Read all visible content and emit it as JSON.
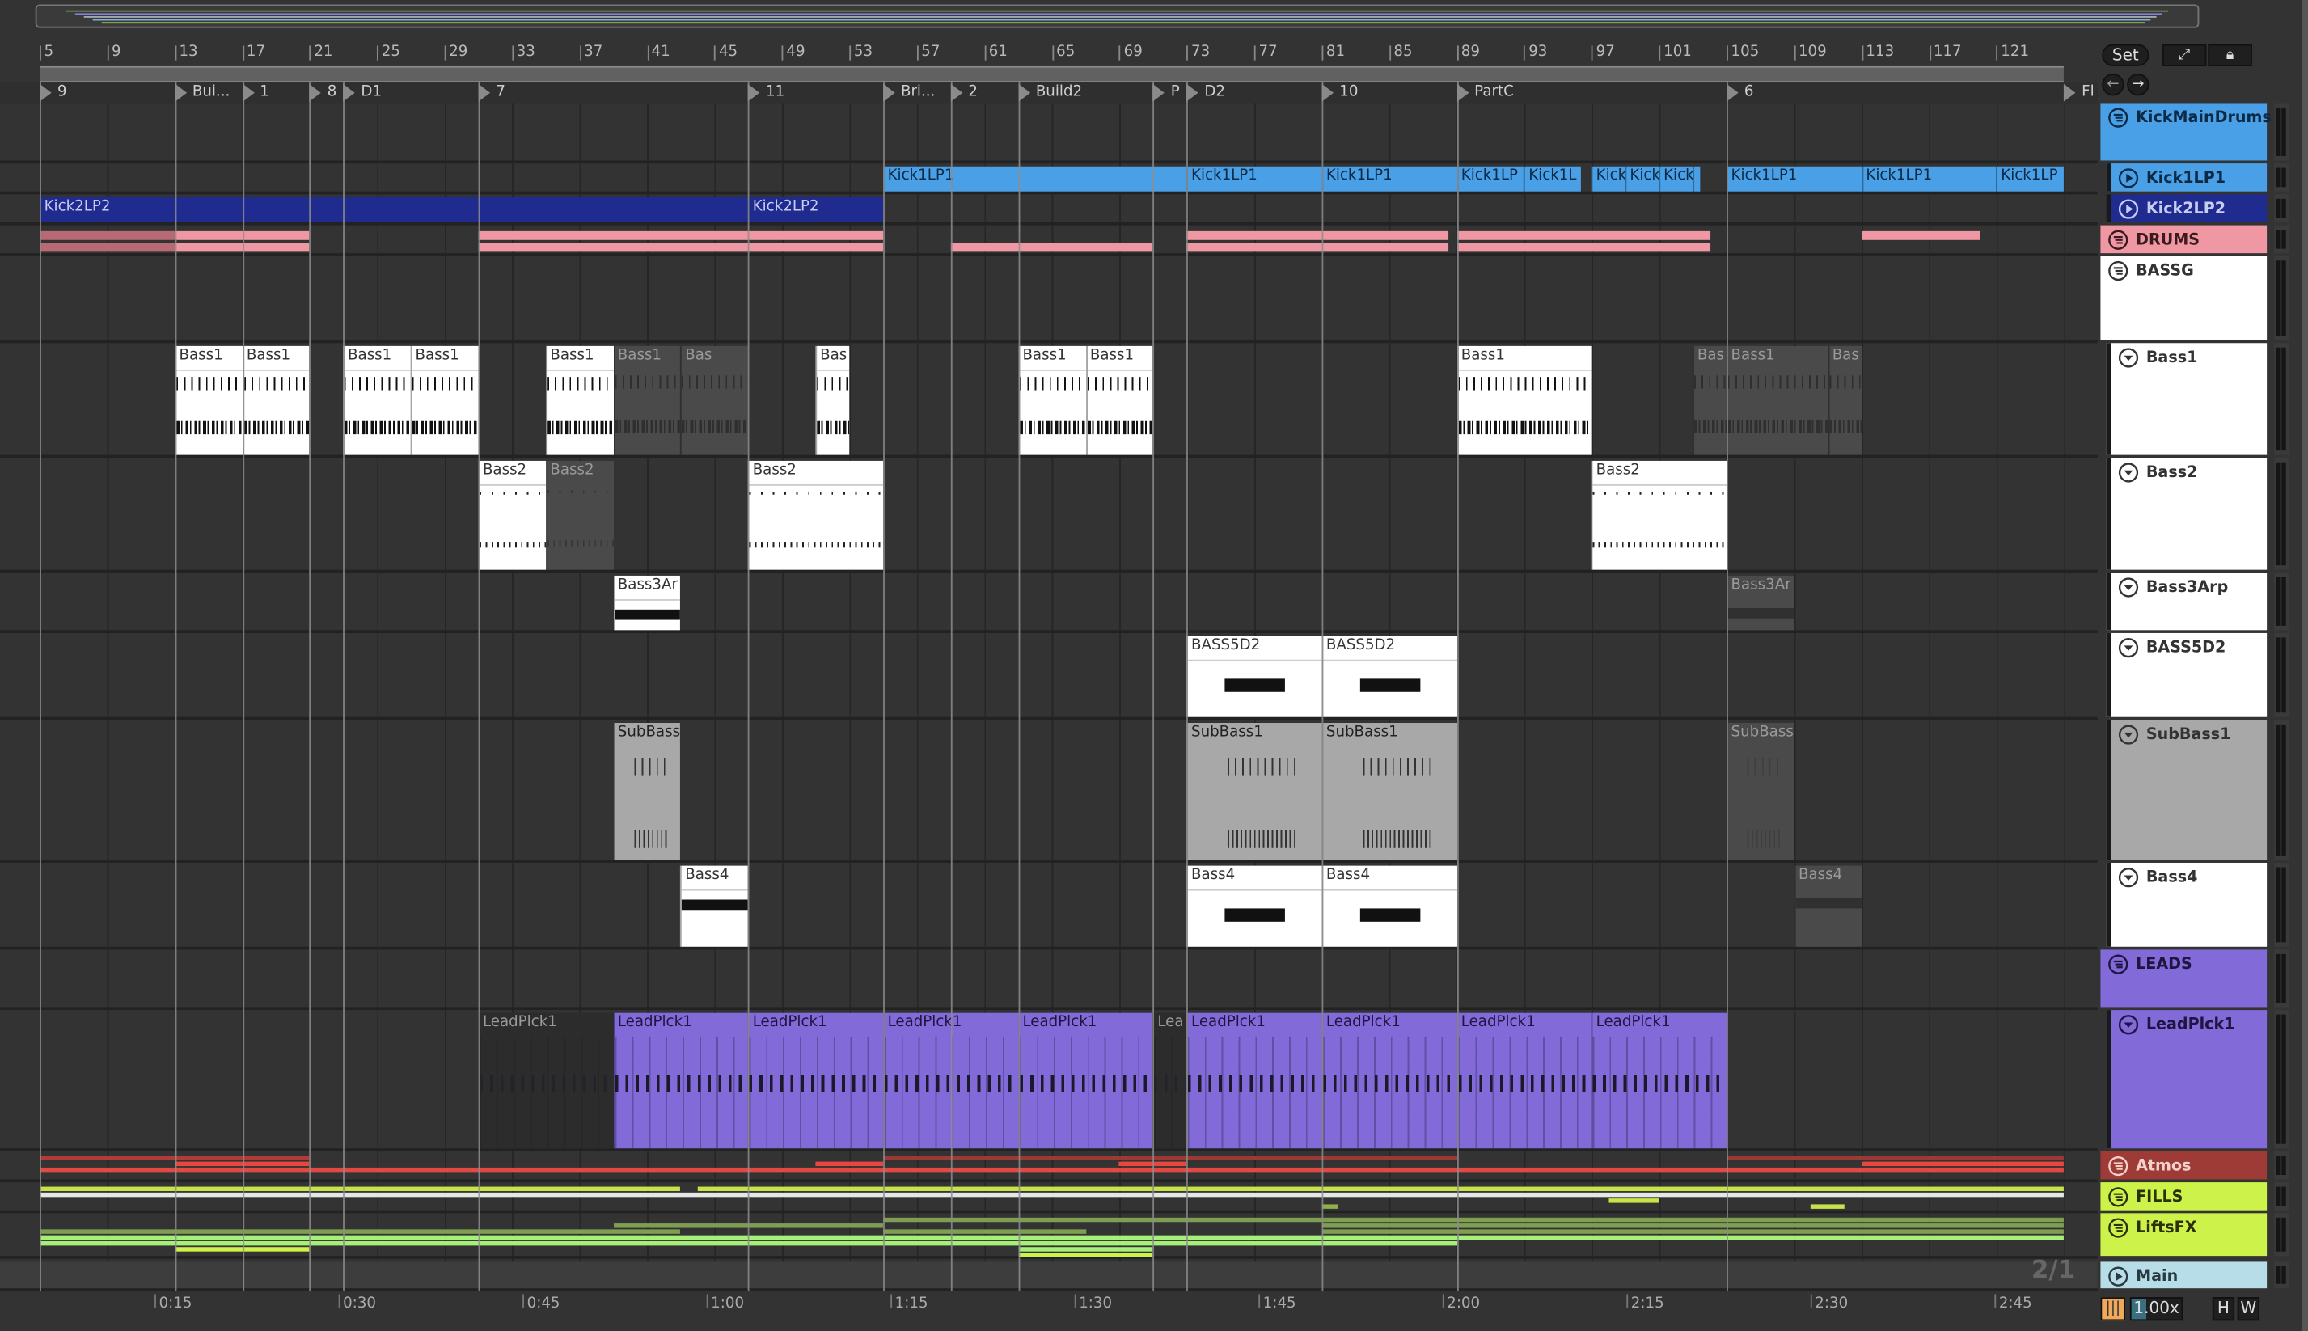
{
  "ruler": {
    "bars": [
      "5",
      "9",
      "13",
      "17",
      "21",
      "25",
      "29",
      "33",
      "37",
      "41",
      "45",
      "49",
      "53",
      "57",
      "61",
      "65",
      "69",
      "73",
      "77",
      "81",
      "85",
      "89",
      "93",
      "97",
      "101",
      "105",
      "109",
      "113",
      "117",
      "121"
    ]
  },
  "locators": [
    {
      "label": "9",
      "bar": 5
    },
    {
      "label": "Bui...",
      "bar": 13
    },
    {
      "label": "1",
      "bar": 17
    },
    {
      "label": "8",
      "bar": 21
    },
    {
      "label": "D1",
      "bar": 23
    },
    {
      "label": "7",
      "bar": 31
    },
    {
      "label": "11",
      "bar": 47
    },
    {
      "label": "Bri...",
      "bar": 55
    },
    {
      "label": "2",
      "bar": 59
    },
    {
      "label": "Build2",
      "bar": 63
    },
    {
      "label": "P",
      "bar": 71
    },
    {
      "label": "D2",
      "bar": 73
    },
    {
      "label": "10",
      "bar": 81
    },
    {
      "label": "PartC",
      "bar": 89
    },
    {
      "label": "6",
      "bar": 105
    },
    {
      "label": "Fl",
      "bar": 125
    }
  ],
  "tracks": [
    {
      "name": "KickMainDrums",
      "color": "#4aa0e6",
      "text": "#0d2a45",
      "icon": "group"
    },
    {
      "name": "Kick1LP1",
      "color": "#4aa0e6",
      "text": "#0d2a45",
      "icon": "play",
      "indent": true
    },
    {
      "name": "Kick2LP2",
      "color": "#1f2b8f",
      "text": "#c8ccf0",
      "icon": "play",
      "indent": true
    },
    {
      "name": "DRUMS",
      "color": "#ef98a3",
      "text": "#3a1a1e",
      "icon": "group"
    },
    {
      "name": "BASSG",
      "color": "#ffffff",
      "text": "#333333",
      "icon": "group"
    },
    {
      "name": "Bass1",
      "color": "#ffffff",
      "text": "#333333",
      "icon": "fold",
      "indent": true
    },
    {
      "name": "Bass2",
      "color": "#ffffff",
      "text": "#333333",
      "icon": "fold",
      "indent": true
    },
    {
      "name": "Bass3Arp",
      "color": "#ffffff",
      "text": "#333333",
      "icon": "fold",
      "indent": true
    },
    {
      "name": "BASS5D2",
      "color": "#ffffff",
      "text": "#333333",
      "icon": "fold",
      "indent": true
    },
    {
      "name": "SubBass1",
      "color": "#a8a8a8",
      "text": "#333333",
      "icon": "fold",
      "indent": true
    },
    {
      "name": "Bass4",
      "color": "#ffffff",
      "text": "#333333",
      "icon": "fold",
      "indent": true
    },
    {
      "name": "LEADS",
      "color": "#826ad9",
      "text": "#1e1640",
      "icon": "group"
    },
    {
      "name": "LeadPlck1",
      "color": "#826ad9",
      "text": "#1e1640",
      "icon": "fold",
      "indent": true
    },
    {
      "name": "Atmos",
      "color": "#9e3b37",
      "text": "#f2d0cc",
      "icon": "group"
    },
    {
      "name": "FILLS",
      "color": "#cdf24a",
      "text": "#2a3008",
      "icon": "group"
    },
    {
      "name": "LiftsFX",
      "color": "#cdf24a",
      "text": "#2a3008",
      "icon": "group"
    },
    {
      "name": "Main",
      "color": "#b7dde8",
      "text": "#2a3a40",
      "icon": "play"
    }
  ],
  "clips": [
    {
      "t": 1,
      "s": 55,
      "e": 73,
      "name": "Kick1LP1",
      "style": "blue"
    },
    {
      "t": 1,
      "s": 73,
      "e": 81,
      "name": "Kick1LP1",
      "style": "blue"
    },
    {
      "t": 1,
      "s": 81,
      "e": 89,
      "name": "Kick1LP1",
      "style": "blue"
    },
    {
      "t": 1,
      "s": 89,
      "e": 93,
      "name": "Kick1LP",
      "style": "blue"
    },
    {
      "t": 1,
      "s": 93,
      "e": 96.4,
      "name": "Kick1L",
      "style": "blue"
    },
    {
      "t": 1,
      "s": 97,
      "e": 99,
      "name": "Kick",
      "style": "blue"
    },
    {
      "t": 1,
      "s": 99,
      "e": 101,
      "name": "Kick",
      "style": "blue"
    },
    {
      "t": 1,
      "s": 101,
      "e": 103,
      "name": "Kick",
      "style": "blue"
    },
    {
      "t": 1,
      "s": 103,
      "e": 103.4,
      "name": "",
      "style": "blue"
    },
    {
      "t": 1,
      "s": 105,
      "e": 113,
      "name": "Kick1LP1",
      "style": "blue"
    },
    {
      "t": 1,
      "s": 113,
      "e": 121,
      "name": "Kick1LP1",
      "style": "blue"
    },
    {
      "t": 1,
      "s": 121,
      "e": 125,
      "name": "Kick1LP",
      "style": "blue"
    },
    {
      "t": 2,
      "s": 5,
      "e": 47,
      "name": "Kick2LP2",
      "style": "navy"
    },
    {
      "t": 2,
      "s": 47,
      "e": 55,
      "name": "Kick2LP2",
      "style": "navy"
    },
    {
      "t": 3,
      "s": 5,
      "e": 13,
      "name": "",
      "style": "pinkdim"
    },
    {
      "t": 3,
      "s": 13,
      "e": 21,
      "name": "",
      "style": "pink"
    },
    {
      "t": 3,
      "s": 31,
      "e": 55,
      "name": "",
      "style": "pink"
    },
    {
      "t": 3,
      "s": 59,
      "e": 71,
      "name": "",
      "style": "pinklow"
    },
    {
      "t": 3,
      "s": 73,
      "e": 88.5,
      "name": "",
      "style": "pink"
    },
    {
      "t": 3,
      "s": 89,
      "e": 104,
      "name": "",
      "style": "pink"
    },
    {
      "t": 3,
      "s": 113,
      "e": 120,
      "name": "",
      "style": "pinktop"
    },
    {
      "t": 5,
      "s": 13,
      "e": 17,
      "name": "Bass1",
      "style": "white",
      "pat": "bass1"
    },
    {
      "t": 5,
      "s": 17,
      "e": 21,
      "name": "Bass1",
      "style": "white",
      "pat": "bass1"
    },
    {
      "t": 5,
      "s": 23,
      "e": 27,
      "name": "Bass1",
      "style": "white",
      "pat": "bass1"
    },
    {
      "t": 5,
      "s": 27,
      "e": 31,
      "name": "Bass1",
      "style": "white",
      "pat": "bass1"
    },
    {
      "t": 5,
      "s": 35,
      "e": 39,
      "name": "Bass1",
      "style": "white",
      "pat": "bass1"
    },
    {
      "t": 5,
      "s": 39,
      "e": 43,
      "name": "Bass1",
      "style": "grey",
      "pat": "bass1"
    },
    {
      "t": 5,
      "s": 43,
      "e": 47,
      "name": "Bas",
      "style": "grey",
      "pat": "bass1"
    },
    {
      "t": 5,
      "s": 51,
      "e": 53,
      "name": "Bas",
      "style": "white",
      "pat": "bass1"
    },
    {
      "t": 5,
      "s": 63,
      "e": 67,
      "name": "Bass1",
      "style": "white",
      "pat": "bass1"
    },
    {
      "t": 5,
      "s": 67,
      "e": 71,
      "name": "Bass1",
      "style": "white",
      "pat": "bass1"
    },
    {
      "t": 5,
      "s": 89,
      "e": 97,
      "name": "Bass1",
      "style": "white",
      "pat": "bass1"
    },
    {
      "t": 5,
      "s": 103,
      "e": 105,
      "name": "Bas",
      "style": "grey",
      "pat": "bass1"
    },
    {
      "t": 5,
      "s": 105,
      "e": 111,
      "name": "Bass1",
      "style": "grey",
      "pat": "bass1"
    },
    {
      "t": 5,
      "s": 111,
      "e": 113,
      "name": "Bas",
      "style": "grey",
      "pat": "bass1"
    },
    {
      "t": 6,
      "s": 31,
      "e": 35,
      "name": "Bass2",
      "style": "white",
      "pat": "bass2"
    },
    {
      "t": 6,
      "s": 35,
      "e": 39,
      "name": "Bass2",
      "style": "grey",
      "pat": "bass2"
    },
    {
      "t": 6,
      "s": 47,
      "e": 55,
      "name": "Bass2",
      "style": "white",
      "pat": "bass2"
    },
    {
      "t": 6,
      "s": 97,
      "e": 105,
      "name": "Bass2",
      "style": "white",
      "pat": "bass2"
    },
    {
      "t": 7,
      "s": 39,
      "e": 43,
      "name": "Bass3Ar",
      "style": "white",
      "pat": "block"
    },
    {
      "t": 7,
      "s": 105,
      "e": 109,
      "name": "Bass3Ar",
      "style": "grey",
      "pat": "block"
    },
    {
      "t": 8,
      "s": 73,
      "e": 81,
      "name": "BASS5D2",
      "style": "white",
      "pat": "long"
    },
    {
      "t": 8,
      "s": 81,
      "e": 89,
      "name": "BASS5D2",
      "style": "white",
      "pat": "long"
    },
    {
      "t": 9,
      "s": 39,
      "e": 43,
      "name": "SubBass",
      "style": "sub",
      "pat": "sub"
    },
    {
      "t": 9,
      "s": 73,
      "e": 81,
      "name": "SubBass1",
      "style": "sub",
      "pat": "sub"
    },
    {
      "t": 9,
      "s": 81,
      "e": 89,
      "name": "SubBass1",
      "style": "sub",
      "pat": "sub"
    },
    {
      "t": 9,
      "s": 105,
      "e": 109,
      "name": "SubBass",
      "style": "grey",
      "pat": "sub"
    },
    {
      "t": 10,
      "s": 43,
      "e": 47,
      "name": "Bass4",
      "style": "white",
      "pat": "block"
    },
    {
      "t": 10,
      "s": 73,
      "e": 81,
      "name": "Bass4",
      "style": "white",
      "pat": "long"
    },
    {
      "t": 10,
      "s": 81,
      "e": 89,
      "name": "Bass4",
      "style": "white",
      "pat": "long"
    },
    {
      "t": 10,
      "s": 109,
      "e": 113,
      "name": "Bass4",
      "style": "grey",
      "pat": "block"
    },
    {
      "t": 12,
      "s": 31,
      "e": 39,
      "name": "LeadPlck1",
      "style": "grey",
      "pat": "lead"
    },
    {
      "t": 12,
      "s": 39,
      "e": 47,
      "name": "LeadPlck1",
      "style": "purple",
      "pat": "lead"
    },
    {
      "t": 12,
      "s": 47,
      "e": 55,
      "name": "LeadPlck1",
      "style": "purple",
      "pat": "lead"
    },
    {
      "t": 12,
      "s": 55,
      "e": 63,
      "name": "LeadPlck1",
      "style": "purple",
      "pat": "lead"
    },
    {
      "t": 12,
      "s": 63,
      "e": 71,
      "name": "LeadPlck1",
      "style": "purple",
      "pat": "lead"
    },
    {
      "t": 12,
      "s": 71,
      "e": 73,
      "name": "Lea",
      "style": "grey",
      "pat": "lead"
    },
    {
      "t": 12,
      "s": 73,
      "e": 81,
      "name": "LeadPlck1",
      "style": "purple",
      "pat": "lead"
    },
    {
      "t": 12,
      "s": 81,
      "e": 89,
      "name": "LeadPlck1",
      "style": "purple",
      "pat": "lead"
    },
    {
      "t": 12,
      "s": 89,
      "e": 97,
      "name": "LeadPlck1",
      "style": "purple",
      "pat": "lead"
    },
    {
      "t": 12,
      "s": 97,
      "e": 105,
      "name": "LeadPlck1",
      "style": "purple",
      "pat": "lead"
    }
  ],
  "lanes": [
    {
      "t": 13,
      "lane": 0,
      "s": 5,
      "e": 21,
      "color": "#b13c37"
    },
    {
      "t": 13,
      "lane": 1,
      "s": 13,
      "e": 21,
      "color": "#e8463f"
    },
    {
      "t": 13,
      "lane": 0,
      "s": 55,
      "e": 89,
      "color": "#9b3935"
    },
    {
      "t": 13,
      "lane": 1,
      "s": 51,
      "e": 55,
      "color": "#e8463f"
    },
    {
      "t": 13,
      "lane": 1,
      "s": 69,
      "e": 73,
      "color": "#e8463f"
    },
    {
      "t": 13,
      "lane": 0,
      "s": 105,
      "e": 125,
      "color": "#9b3935"
    },
    {
      "t": 13,
      "lane": 1,
      "s": 113,
      "e": 125,
      "color": "#e8463f"
    },
    {
      "t": 13,
      "lane": 2,
      "s": 5,
      "e": 125,
      "color": "#e04a42"
    },
    {
      "t": 14,
      "lane": 0,
      "s": 5,
      "e": 43,
      "color": "#c6e34a"
    },
    {
      "t": 14,
      "lane": 0,
      "s": 44,
      "e": 125,
      "color": "#c6e34a"
    },
    {
      "t": 14,
      "lane": 1,
      "s": 5,
      "e": 125,
      "color": "#e6e6e6"
    },
    {
      "t": 14,
      "lane": 3,
      "s": 81,
      "e": 82,
      "color": "#8fb04a"
    },
    {
      "t": 14,
      "lane": 2,
      "s": 98,
      "e": 101,
      "color": "#c6e34a"
    },
    {
      "t": 14,
      "lane": 3,
      "s": 110,
      "e": 112,
      "color": "#c6e34a"
    },
    {
      "t": 15,
      "lane": 0,
      "s": 55,
      "e": 125,
      "color": "#7f9e52"
    },
    {
      "t": 15,
      "lane": 1,
      "s": 39,
      "e": 55,
      "color": "#7f9e52"
    },
    {
      "t": 15,
      "lane": 1,
      "s": 81,
      "e": 125,
      "color": "#7f9e52"
    },
    {
      "t": 15,
      "lane": 2,
      "s": 5,
      "e": 43,
      "color": "#7f9e52"
    },
    {
      "t": 15,
      "lane": 2,
      "s": 55,
      "e": 67,
      "color": "#7f9e52"
    },
    {
      "t": 15,
      "lane": 2,
      "s": 81,
      "e": 125,
      "color": "#7f9e52"
    },
    {
      "t": 15,
      "lane": 3,
      "s": 5,
      "e": 125,
      "color": "#a6f07a"
    },
    {
      "t": 15,
      "lane": 4,
      "s": 5,
      "e": 89,
      "color": "#a6f07a"
    },
    {
      "t": 15,
      "lane": 5,
      "s": 13,
      "e": 21,
      "color": "#cdf24a"
    },
    {
      "t": 15,
      "lane": 5,
      "s": 63,
      "e": 71,
      "color": "#a6f07a"
    },
    {
      "t": 15,
      "lane": 6,
      "s": 63,
      "e": 71,
      "color": "#cdf24a"
    }
  ],
  "time_ruler": [
    "0:15",
    "0:30",
    "0:45",
    "1:00",
    "1:15",
    "1:30",
    "1:45",
    "2:00",
    "2:15",
    "2:30",
    "2:45"
  ],
  "controls": {
    "set": "Set",
    "zoom_value": "1.00x",
    "h": "H",
    "w": "W",
    "meter_ratio": "2/1"
  }
}
